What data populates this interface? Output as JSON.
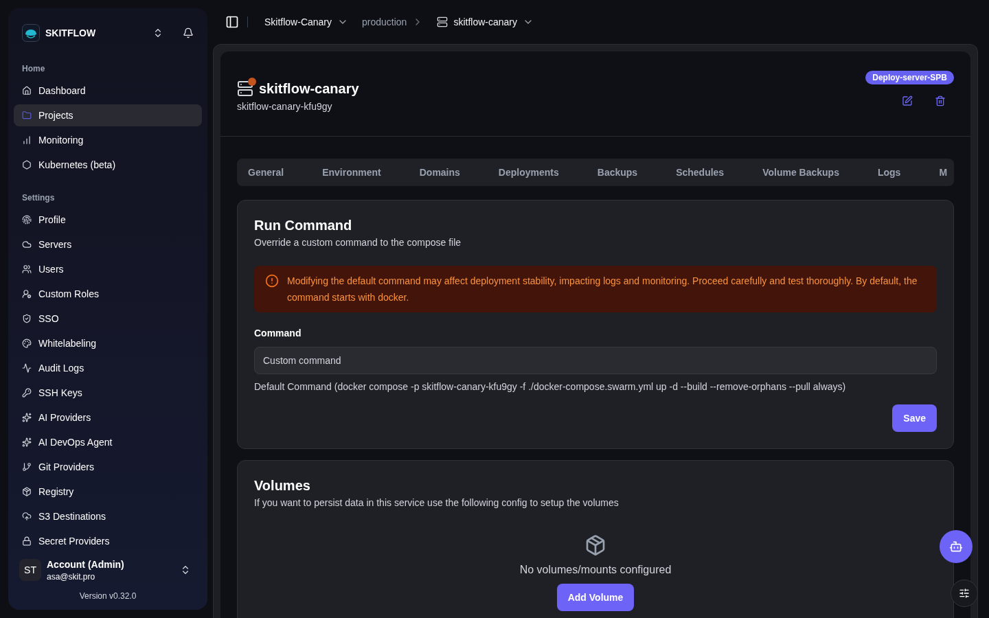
{
  "sidebar": {
    "brand": "SKITFLOW",
    "sections": [
      {
        "title": "Home",
        "items": [
          {
            "label": "Dashboard",
            "selected": false
          },
          {
            "label": "Projects",
            "selected": true
          },
          {
            "label": "Monitoring",
            "selected": false
          },
          {
            "label": "Kubernetes (beta)",
            "selected": false
          }
        ]
      },
      {
        "title": "Settings",
        "items": [
          {
            "label": "Profile",
            "selected": false
          },
          {
            "label": "Servers",
            "selected": false
          },
          {
            "label": "Users",
            "selected": false
          },
          {
            "label": "Custom Roles",
            "selected": false
          },
          {
            "label": "SSO",
            "selected": false
          },
          {
            "label": "Whitelabeling",
            "selected": false
          },
          {
            "label": "Audit Logs",
            "selected": false
          },
          {
            "label": "SSH Keys",
            "selected": false
          },
          {
            "label": "AI Providers",
            "selected": false
          },
          {
            "label": "AI DevOps Agent",
            "selected": false
          },
          {
            "label": "Git Providers",
            "selected": false
          },
          {
            "label": "Registry",
            "selected": false
          },
          {
            "label": "S3 Destinations",
            "selected": false
          },
          {
            "label": "Secret Providers",
            "selected": false
          }
        ]
      }
    ],
    "account": {
      "initials": "ST",
      "name": "Account (Admin)",
      "email": "asa@skit.pro"
    },
    "version": "Version v0.32.0"
  },
  "breadcrumbs": {
    "project": "Skitflow-Canary",
    "environment": "production",
    "service": "skitflow-canary"
  },
  "service": {
    "name": "skitflow-canary",
    "app_name": "skitflow-canary-kfu9gy",
    "server_badge": "Deploy-server-SPB"
  },
  "tabs": [
    {
      "label": "General",
      "selected": false
    },
    {
      "label": "Environment",
      "selected": false
    },
    {
      "label": "Domains",
      "selected": false
    },
    {
      "label": "Deployments",
      "selected": false
    },
    {
      "label": "Backups",
      "selected": false
    },
    {
      "label": "Schedules",
      "selected": false
    },
    {
      "label": "Volume Backups",
      "selected": false
    },
    {
      "label": "Logs",
      "selected": false
    },
    {
      "label": "M",
      "selected": false
    }
  ],
  "run_command": {
    "title": "Run Command",
    "description": "Override a custom command to the compose file",
    "warning": "Modifying the default command may affect deployment stability, impacting logs and monitoring. Proceed carefully and test thoroughly. By default, the command starts with docker.",
    "field_label": "Command",
    "placeholder": "Custom command",
    "hint": "Default Command (docker compose -p skitflow-canary-kfu9gy -f ./docker-compose.swarm.yml up -d --build --remove-orphans --pull always)",
    "save": "Save"
  },
  "volumes": {
    "title": "Volumes",
    "description": "If you want to persist data in this service use the following config to setup the volumes",
    "empty": "No volumes/mounts configured",
    "add": "Add Volume"
  }
}
